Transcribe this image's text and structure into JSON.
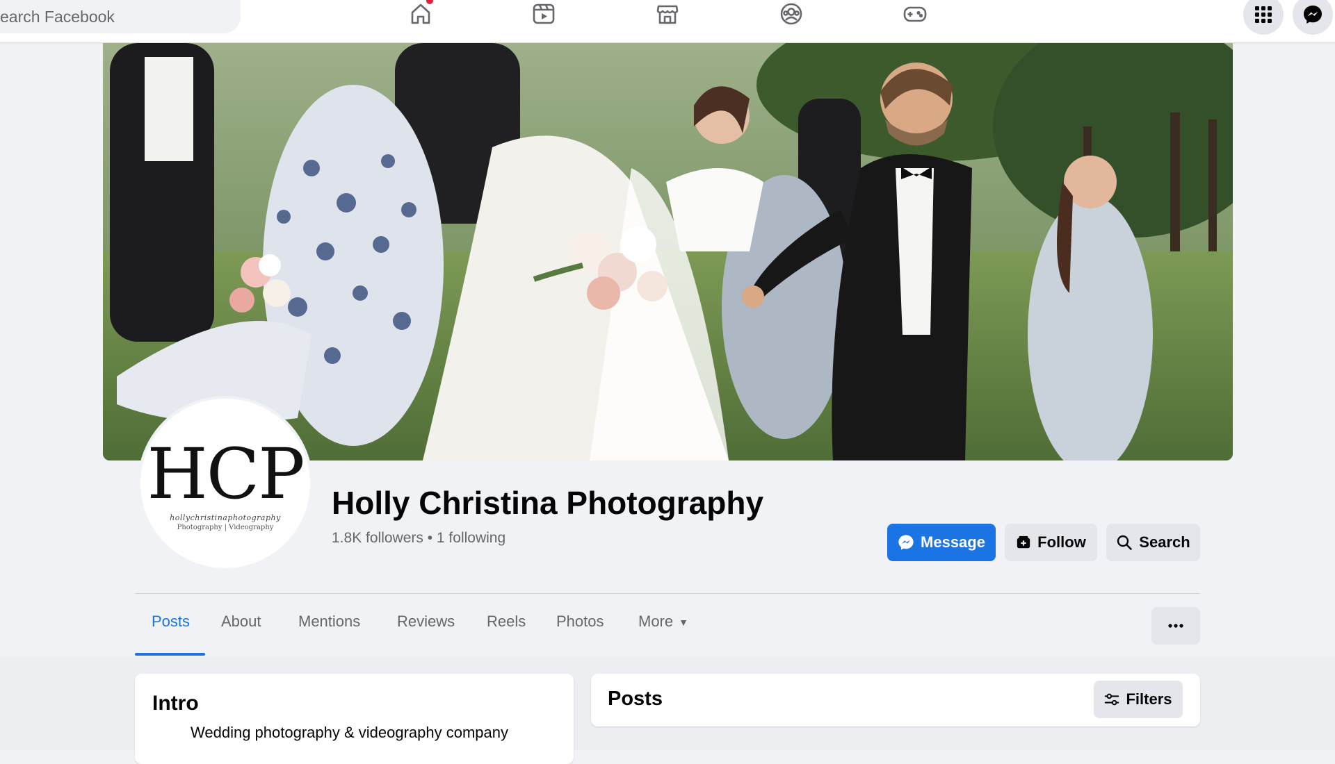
{
  "search": {
    "placeholder": "earch Facebook"
  },
  "nav": {
    "icons": [
      "home-icon",
      "video-icon",
      "marketplace-icon",
      "groups-icon",
      "gaming-icon"
    ],
    "right_icons": [
      "menu-grid-icon",
      "messenger-icon"
    ],
    "notification_dot": true
  },
  "profile": {
    "logo_letters": "HCP",
    "logo_script": "hollychristinaphotography",
    "logo_sub": "Photography | Videography",
    "name": "Holly Christina Photography",
    "stats": "1.8K followers • 1 following"
  },
  "actions": {
    "message": "Message",
    "follow": "Follow",
    "search": "Search"
  },
  "tabs": {
    "items": [
      "Posts",
      "About",
      "Mentions",
      "Reviews",
      "Reels",
      "Photos",
      "More"
    ],
    "active": "Posts",
    "more_options": "···"
  },
  "intro": {
    "title": "Intro",
    "text": "Wedding photography & videography company"
  },
  "posts": {
    "title": "Posts",
    "filters": "Filters"
  },
  "colors": {
    "accent": "#1b74e4",
    "background": "#f0f2f5",
    "secondary_button": "#e4e6eb",
    "notification": "#e41e3f"
  }
}
